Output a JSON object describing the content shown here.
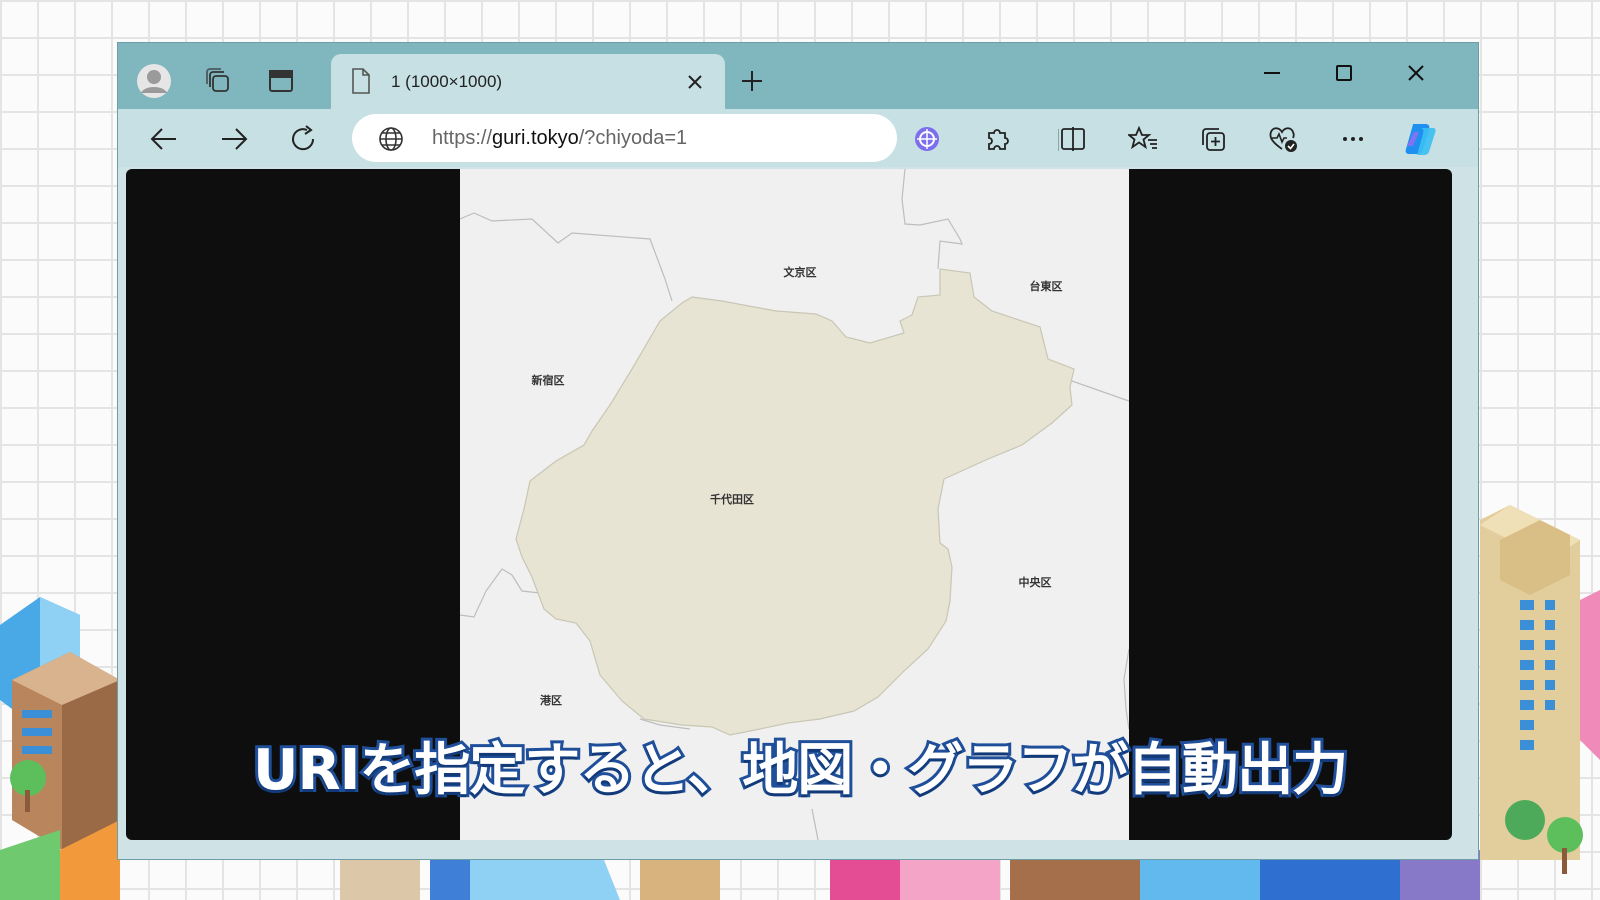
{
  "browser": {
    "tab": {
      "title": "1 (1000×1000)"
    },
    "address": {
      "scheme": "https://",
      "host": "guri.tokyo",
      "path": "/?chiyoda=1"
    }
  },
  "map": {
    "wards": {
      "bunkyo": "文京区",
      "taito": "台東区",
      "shinjuku": "新宿区",
      "chiyoda": "千代田区",
      "chuo": "中央区",
      "minato": "港区"
    },
    "colors": {
      "highlight_fill": "#e8e4d4",
      "background": "#f0f0f0",
      "border": "#bdbdbd"
    }
  },
  "caption": {
    "text": "URIを指定すると、地図・グラフが自動出力"
  },
  "colors": {
    "titlebar": "#80b6be",
    "toolbar": "#c6e0e3",
    "caption_stroke": "#1f4f9a"
  },
  "icons": {
    "profile": "profile-icon",
    "workspaces": "workspaces-icon",
    "tab_actions": "vertical-tabs-icon",
    "page": "page-icon",
    "close": "close-icon",
    "new_tab": "plus-icon",
    "back": "back-arrow-icon",
    "forward": "forward-arrow-icon",
    "refresh": "refresh-icon",
    "site_info": "globe-icon",
    "extension_1": "copilot-extension-icon",
    "extensions": "puzzle-icon",
    "split": "split-screen-icon",
    "favorites": "favorites-icon",
    "collections": "collections-icon",
    "performance": "heart-pulse-icon",
    "more": "more-icon",
    "copilot": "copilot-icon"
  }
}
